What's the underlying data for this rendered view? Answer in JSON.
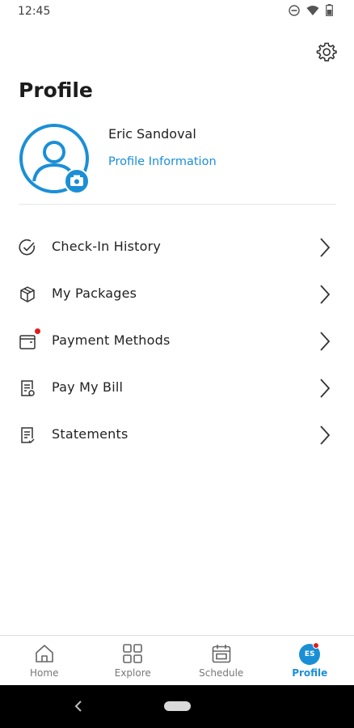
{
  "status_bar": {
    "time": "12:45",
    "icons": [
      "do-not-disturb-icon",
      "wifi-icon",
      "battery-icon"
    ]
  },
  "header": {
    "title": "Profile",
    "settings_icon": "gear-icon"
  },
  "user": {
    "name": "Eric Sandoval",
    "profile_link": "Profile Information",
    "initials": "ES"
  },
  "menu": {
    "items": [
      {
        "label": "Check-In History",
        "icon": "check-circle-icon"
      },
      {
        "label": "My Packages",
        "icon": "package-icon"
      },
      {
        "label": "Payment Methods",
        "icon": "wallet-icon",
        "has_notification": true
      },
      {
        "label": "Pay My Bill",
        "icon": "bill-icon"
      },
      {
        "label": "Statements",
        "icon": "statement-icon"
      }
    ]
  },
  "bottom_nav": {
    "items": [
      {
        "label": "Home",
        "icon": "home-icon"
      },
      {
        "label": "Explore",
        "icon": "grid-icon"
      },
      {
        "label": "Schedule",
        "icon": "calendar-icon"
      },
      {
        "label": "Profile",
        "icon": "avatar",
        "active": true
      }
    ]
  },
  "colors": {
    "accent": "#1b8fd6",
    "notification": "#e21b1b",
    "text": "#1f1f1f"
  }
}
